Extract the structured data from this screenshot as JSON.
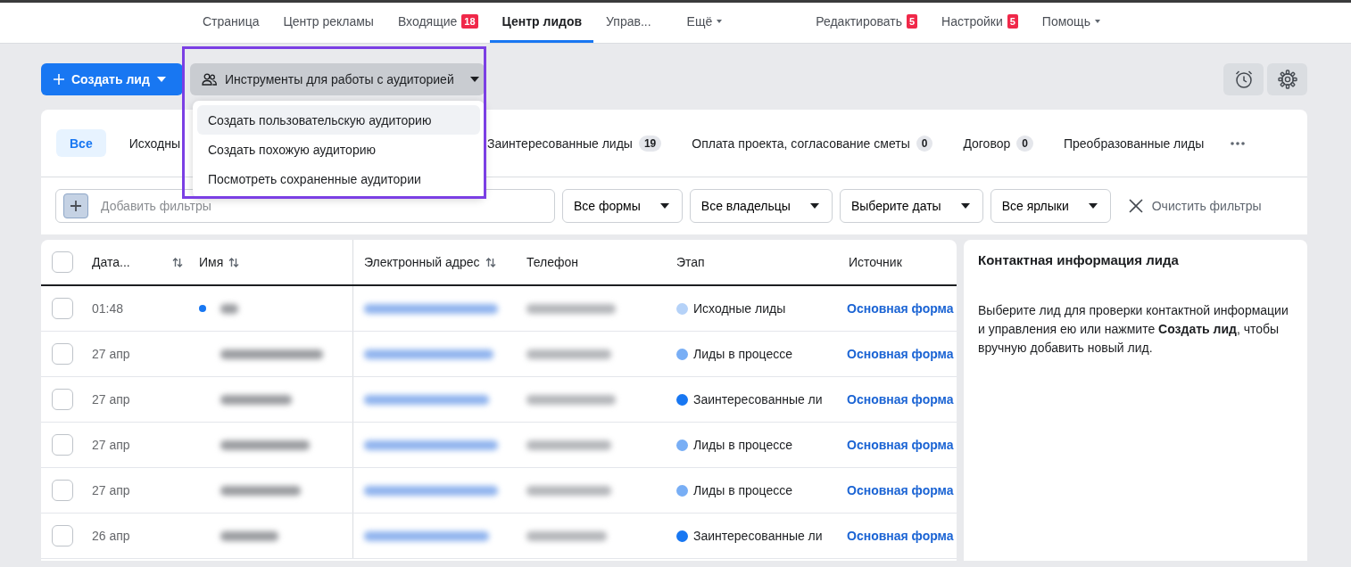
{
  "top_nav": {
    "left_items": [
      {
        "label": "Страница",
        "selected": false,
        "dropdown": false
      },
      {
        "label": "Центр рекламы",
        "selected": false,
        "dropdown": false
      },
      {
        "label": "Входящие",
        "badge": "18",
        "selected": false,
        "dropdown": false
      },
      {
        "label": "Центр лидов",
        "selected": true,
        "dropdown": false
      },
      {
        "label": "Управ...",
        "selected": false,
        "dropdown": false
      },
      {
        "label": "Ещё",
        "selected": false,
        "dropdown": true
      }
    ],
    "right_items": [
      {
        "label": "Редактировать",
        "badge": "5",
        "selected": false,
        "dropdown": false
      },
      {
        "label": "Настройки",
        "badge": "5",
        "selected": false,
        "dropdown": false
      },
      {
        "label": "Помощь",
        "selected": false,
        "dropdown": true
      }
    ]
  },
  "toolbar": {
    "create_button": {
      "label": "Создать лид"
    },
    "audience_tools": {
      "label": "Инструменты для работы с аудиторией",
      "highlighted": true,
      "expanded": true,
      "menu": [
        {
          "label": "Создать пользовательскую аудиторию",
          "selected": true
        },
        {
          "label": "Создать похожую аудиторию",
          "selected": false
        },
        {
          "label": "Посмотреть сохраненные аудитории",
          "selected": false
        }
      ]
    }
  },
  "stage_tabs": [
    {
      "label": "Все",
      "selected": true
    },
    {
      "label": "Исходны",
      "selected": false
    },
    {
      "label": "Заинтересованные лиды",
      "count": "19",
      "selected": false
    },
    {
      "label": "Оплата проекта, согласование сметы",
      "count": "0",
      "selected": false
    },
    {
      "label": "Договор",
      "count": "0",
      "selected": false
    },
    {
      "label": "Преобразованные лиды",
      "selected": false
    }
  ],
  "filters": {
    "placeholder": "Добавить фильтры",
    "dropdowns": [
      "Все формы",
      "Все владельцы",
      "Выберите даты",
      "Все ярлыки"
    ],
    "clear": "Очистить фильтры"
  },
  "table": {
    "select_all_checked": false,
    "columns": [
      {
        "label": "Дата...",
        "sortable": true
      },
      {
        "label": "Имя",
        "sortable": true
      },
      {
        "label": "Электронный адрес",
        "sortable": true
      },
      {
        "label": "Телефон",
        "sortable": false
      },
      {
        "label": "Этап",
        "sortable": false
      },
      {
        "label": "Источник",
        "sortable": false
      }
    ],
    "rows": [
      {
        "date": "01:48",
        "unread": true,
        "checked": false,
        "stage": "Исходные лиды",
        "color": "#b5d2f8",
        "source": "Основная форма"
      },
      {
        "date": "27 апр",
        "unread": false,
        "checked": false,
        "stage": "Лиды в процессе",
        "color": "#78aef5",
        "source": "Основная форма"
      },
      {
        "date": "27 апр",
        "unread": false,
        "checked": false,
        "stage": "Заинтересованные ли",
        "color": "#1877f2",
        "source": "Основная форма"
      },
      {
        "date": "27 апр",
        "unread": false,
        "checked": false,
        "stage": "Лиды в процессе",
        "color": "#78aef5",
        "source": "Основная форма"
      },
      {
        "date": "27 апр",
        "unread": false,
        "checked": false,
        "stage": "Лиды в процессе",
        "color": "#78aef5",
        "source": "Основная форма"
      },
      {
        "date": "26 апр",
        "unread": false,
        "checked": false,
        "stage": "Заинтересованные ли",
        "color": "#1877f2",
        "source": "Основная форма"
      }
    ]
  },
  "contact_panel": {
    "title": "Контактная информация лида",
    "text": "Выберите лид для проверки контактной информации и управления ею или нажмите **Создать лид**, чтобы вручную добавить новый лид."
  }
}
